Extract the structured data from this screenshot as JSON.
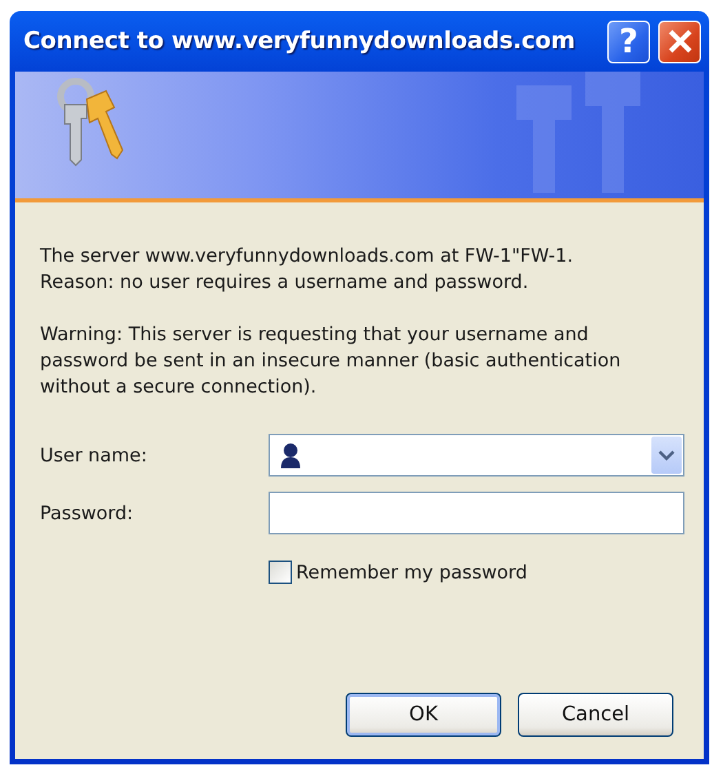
{
  "window": {
    "title": "Connect to www.veryfunnydownloads.com"
  },
  "title_buttons": [
    {
      "kind": "help",
      "glyph": "?"
    },
    {
      "kind": "close"
    }
  ],
  "messages": [
    "The server www.veryfunnydownloads.com at FW-1\"FW-1.\nReason: no user requires a username and password.",
    "Warning: This server is requesting that your username and\npassword be sent in an insecure manner (basic authentication\nwithout a secure connection)."
  ],
  "fields": [
    {
      "kind": "combo",
      "label": "User name:"
    },
    {
      "kind": "password",
      "label": "Password:"
    }
  ],
  "remember": {
    "label": "Remember my password",
    "checked": false
  },
  "buttons": [
    {
      "label": "OK",
      "default": true
    },
    {
      "label": "Cancel",
      "default": false
    }
  ]
}
